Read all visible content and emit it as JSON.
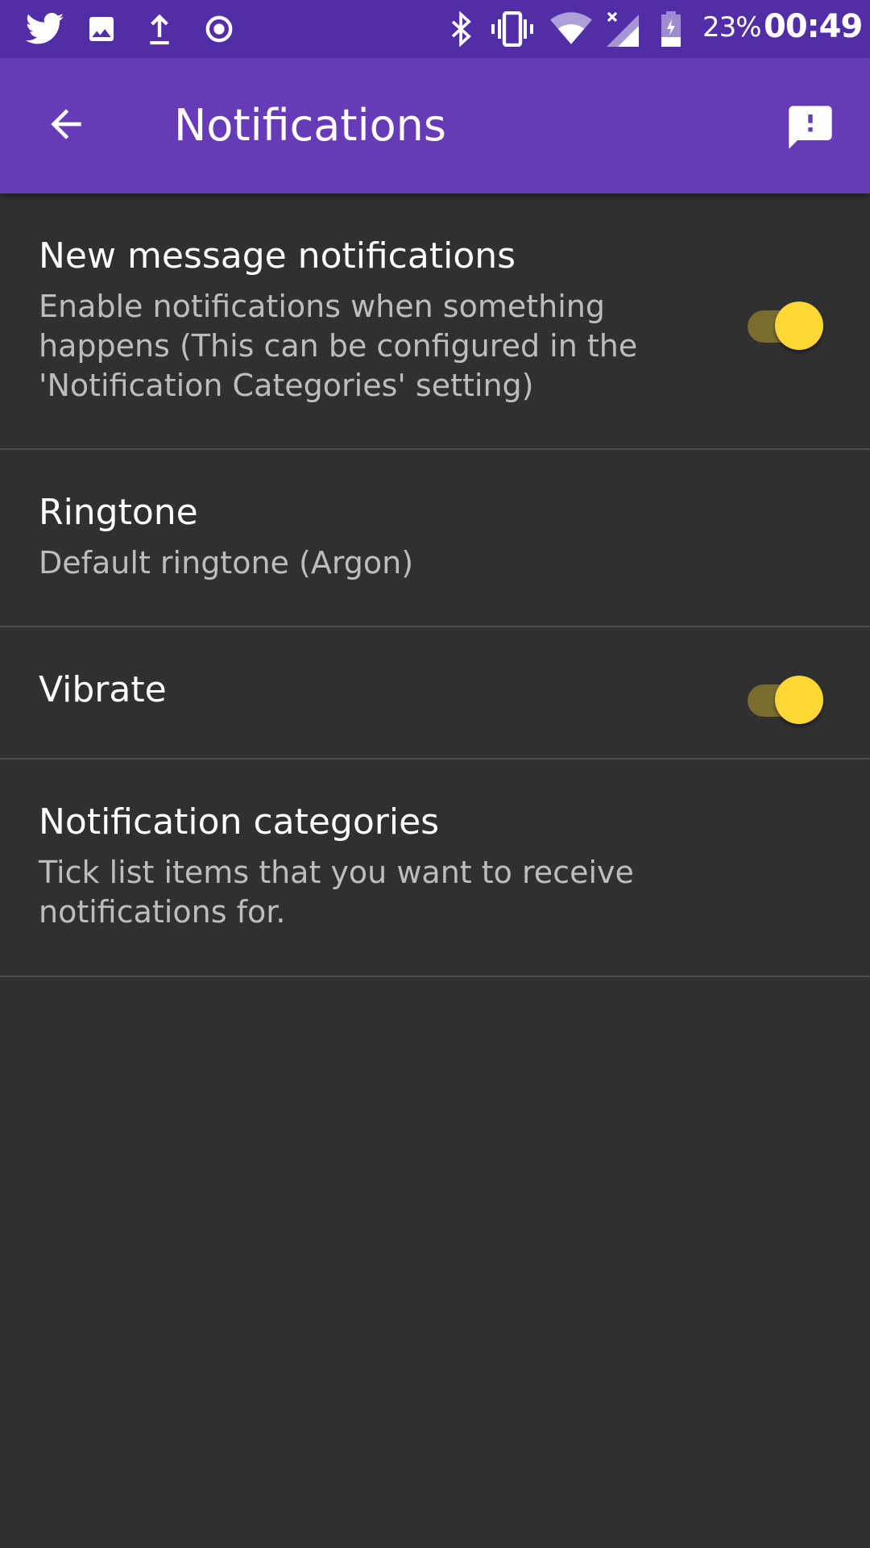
{
  "status_bar": {
    "left_icons": [
      "twitter-icon",
      "image-icon",
      "upload-icon",
      "record-icon"
    ],
    "right_icons": [
      "bluetooth-icon",
      "vibrate-icon",
      "wifi-icon",
      "signal-icon",
      "battery-icon"
    ],
    "battery_percent": "23%",
    "time": "00:49"
  },
  "app_bar": {
    "title": "Notifications",
    "back_icon": "arrow-back-icon",
    "action_icon": "feedback-icon",
    "color": "#673ab7",
    "status_color": "#512da8"
  },
  "settings": {
    "new_message": {
      "title": "New message notifications",
      "summary": "Enable notifications when something happens (This can be configured in the 'Notification Categories' setting)",
      "enabled": true
    },
    "ringtone": {
      "title": "Ringtone",
      "summary": "Default ringtone (Argon)"
    },
    "vibrate": {
      "title": "Vibrate",
      "enabled": true
    },
    "categories": {
      "title": "Notification categories",
      "summary": "Tick list items that you want to receive notifications for."
    }
  },
  "theme": {
    "background": "#303030",
    "accent": "#fdd835",
    "divider": "#4b4b4b"
  }
}
